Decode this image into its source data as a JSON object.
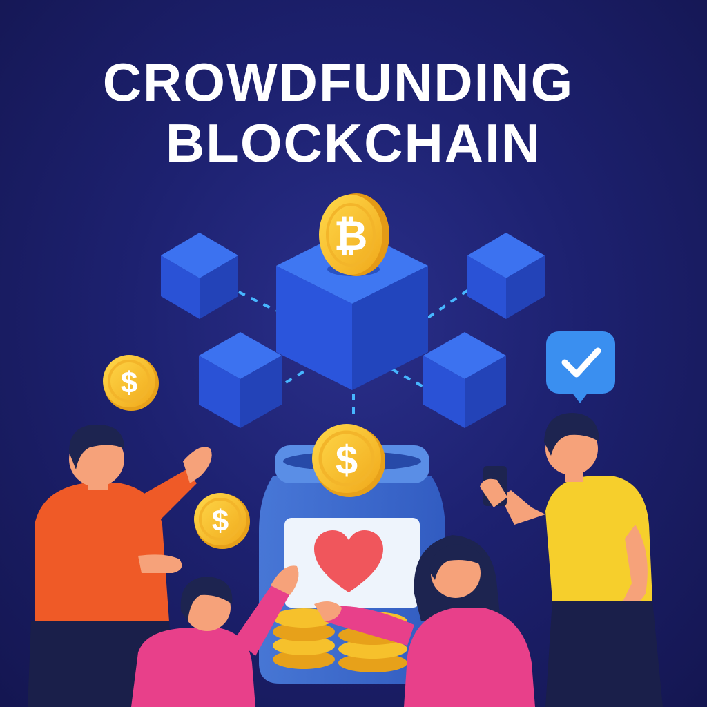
{
  "title": {
    "line1": "CROWDFUNDING",
    "line2": "BLOCKCHAIN"
  },
  "colors": {
    "background": "#1d2170",
    "block": "#2f5be0",
    "coin": "#f6c12c",
    "check_badge": "#3a8ff0",
    "heart": "#f0565c",
    "person_orange": "#ef5a27",
    "person_yellow": "#f6cf2c",
    "person_pink": "#e8408a"
  },
  "icons": [
    "bitcoin-icon",
    "dollar-icon",
    "check-icon",
    "heart-icon",
    "phone-icon"
  ]
}
